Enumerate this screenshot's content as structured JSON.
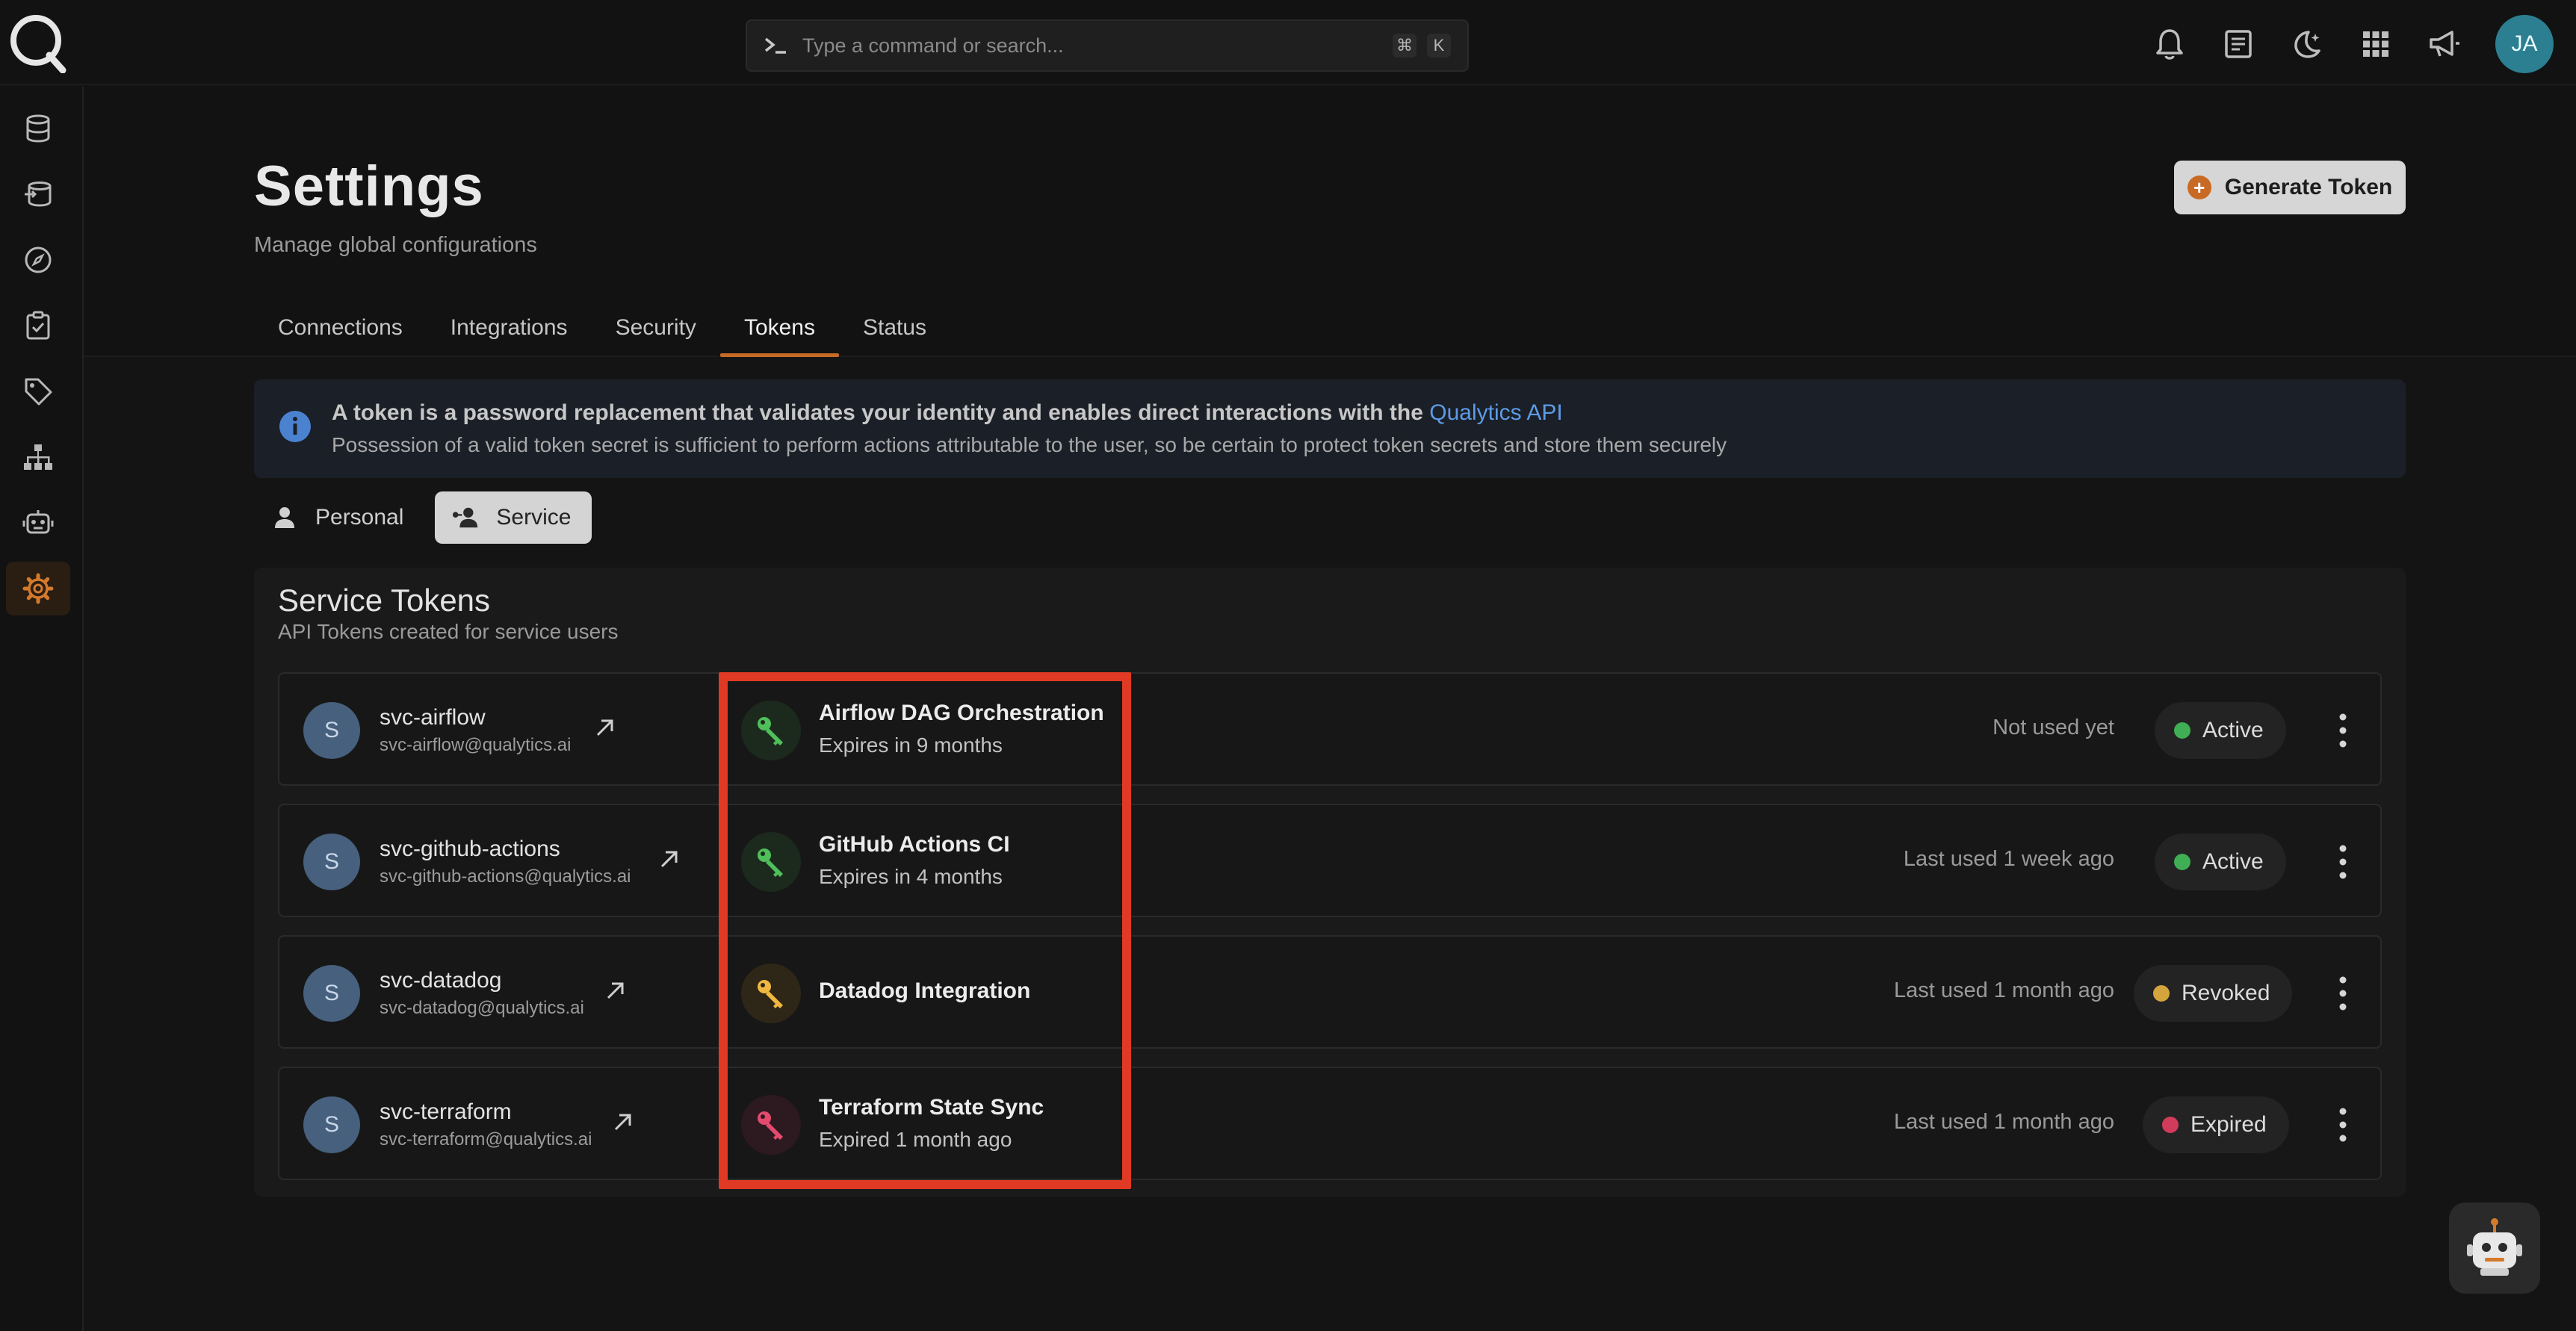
{
  "topbar": {
    "search_placeholder": "Type a command or search...",
    "shortcut_keys": [
      "⌘",
      "K"
    ],
    "icons": [
      "bell-icon",
      "document-icon",
      "moon-icon",
      "apps-grid-icon",
      "megaphone-icon"
    ],
    "user_initials": "JA"
  },
  "sidebar": {
    "items": [
      "database-icon",
      "stacked-database-icon",
      "compass-icon",
      "checklist-icon",
      "tag-icon",
      "hierarchy-icon",
      "robot-icon",
      "gear-icon"
    ],
    "active_index": 7
  },
  "page": {
    "title": "Settings",
    "subtitle": "Manage global configurations",
    "generate_label": "Generate Token"
  },
  "tabs": [
    {
      "label": "Connections",
      "active": false
    },
    {
      "label": "Integrations",
      "active": false
    },
    {
      "label": "Security",
      "active": false
    },
    {
      "label": "Tokens",
      "active": true
    },
    {
      "label": "Status",
      "active": false
    }
  ],
  "banner": {
    "line1": "A token is a password replacement that validates your identity and enables direct interactions with the ",
    "link": "Qualytics API",
    "line2": "Possession of a valid token secret is sufficient to perform actions attributable to the user, so be certain to protect token secrets and store them securely"
  },
  "toggle": {
    "personal": "Personal",
    "service": "Service",
    "active": "service"
  },
  "service_tokens": {
    "title": "Service Tokens",
    "subtitle": "API Tokens created for service users",
    "rows": [
      {
        "initial": "S",
        "name": "svc-airflow",
        "email": "svc-airflow@qualytics.ai",
        "token_name": "Airflow DAG Orchestration",
        "expiry": "Expires in 9 months",
        "last_used": "Not used yet",
        "status": "Active",
        "status_color": "#3fae54",
        "key_color": "#4fbf5a",
        "key_bg": "#1c2a1e"
      },
      {
        "initial": "S",
        "name": "svc-github-actions",
        "email": "svc-github-actions@qualytics.ai",
        "token_name": "GitHub Actions CI",
        "expiry": "Expires in 4 months",
        "last_used": "Last used 1 week ago",
        "status": "Active",
        "status_color": "#3fae54",
        "key_color": "#4fbf5a",
        "key_bg": "#1c2a1e"
      },
      {
        "initial": "S",
        "name": "svc-datadog",
        "email": "svc-datadog@qualytics.ai",
        "token_name": "Datadog Integration",
        "expiry": "",
        "last_used": "Last used 1 month ago",
        "status": "Revoked",
        "status_color": "#d4a53c",
        "key_color": "#f0b840",
        "key_bg": "#2e2617"
      },
      {
        "initial": "S",
        "name": "svc-terraform",
        "email": "svc-terraform@qualytics.ai",
        "token_name": "Terraform State Sync",
        "expiry": "Expired 1 month ago",
        "last_used": "Last used 1 month ago",
        "status": "Expired",
        "status_color": "#d23b5a",
        "key_color": "#e44a6e",
        "key_bg": "#2d1920"
      }
    ]
  },
  "colors": {
    "accent": "#c66a25",
    "highlight": "#e03a24",
    "link": "#5d9be6"
  }
}
